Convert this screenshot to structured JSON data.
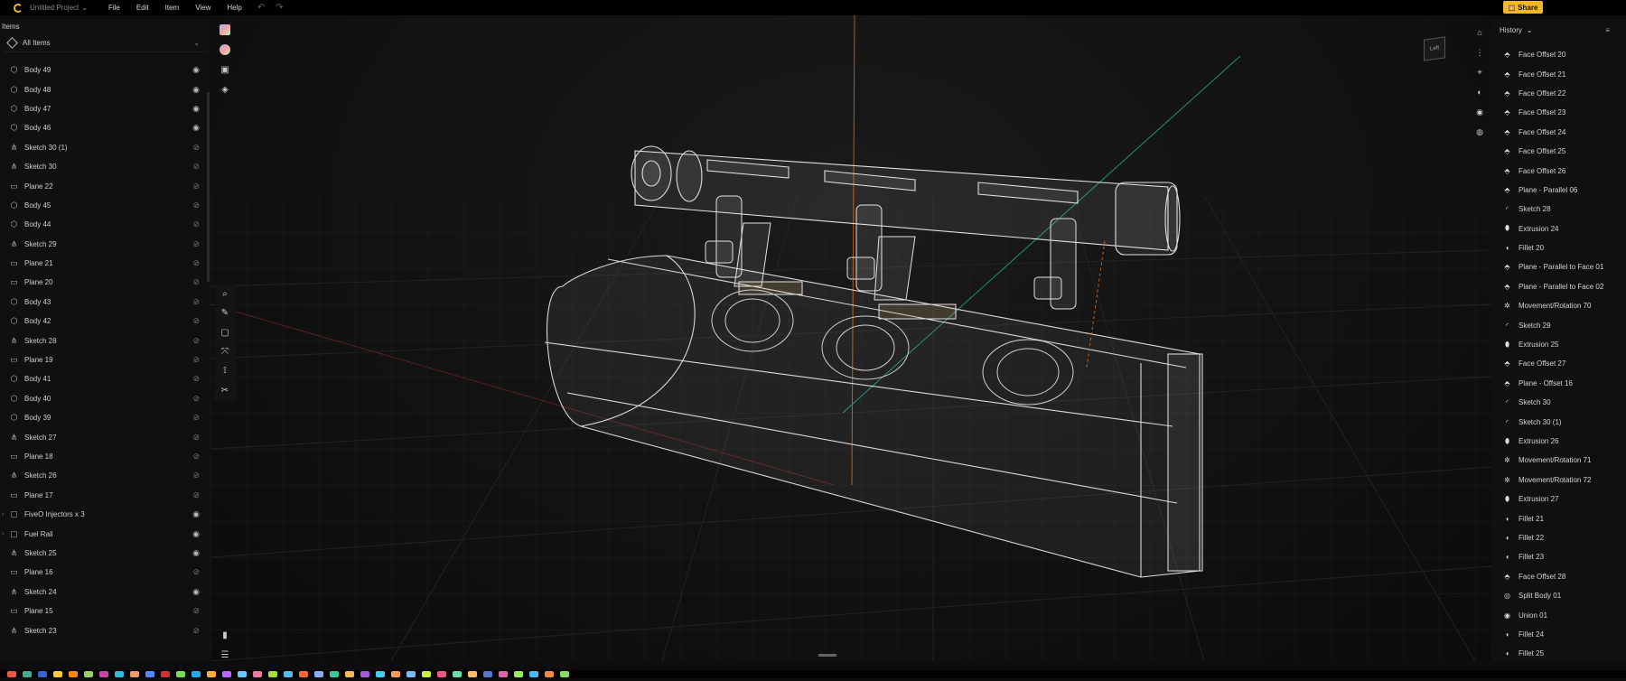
{
  "app": {
    "project_name": "Untitled Project",
    "menu": [
      "File",
      "Edit",
      "Item",
      "View",
      "Help"
    ],
    "share_label": "Share"
  },
  "left_panel": {
    "header": "Items",
    "filter_label": "All Items",
    "items": [
      {
        "label": "Body 49",
        "type": "body",
        "visible": true
      },
      {
        "label": "Body 48",
        "type": "body",
        "visible": true
      },
      {
        "label": "Body 47",
        "type": "body",
        "visible": true
      },
      {
        "label": "Body 46",
        "type": "body",
        "visible": true
      },
      {
        "label": "Sketch 30 (1)",
        "type": "sketch",
        "visible": false
      },
      {
        "label": "Sketch 30",
        "type": "sketch",
        "visible": false
      },
      {
        "label": "Plane 22",
        "type": "plane",
        "visible": false
      },
      {
        "label": "Body 45",
        "type": "body",
        "visible": false
      },
      {
        "label": "Body 44",
        "type": "body",
        "visible": false
      },
      {
        "label": "Sketch 29",
        "type": "sketch",
        "visible": false
      },
      {
        "label": "Plane 21",
        "type": "plane",
        "visible": false
      },
      {
        "label": "Plane 20",
        "type": "plane",
        "visible": false
      },
      {
        "label": "Body 43",
        "type": "body",
        "visible": false
      },
      {
        "label": "Body 42",
        "type": "body",
        "visible": false
      },
      {
        "label": "Sketch 28",
        "type": "sketch",
        "visible": false
      },
      {
        "label": "Plane 19",
        "type": "plane",
        "visible": false
      },
      {
        "label": "Body 41",
        "type": "body",
        "visible": false
      },
      {
        "label": "Body 40",
        "type": "body",
        "visible": false
      },
      {
        "label": "Body 39",
        "type": "body",
        "visible": false
      },
      {
        "label": "Sketch 27",
        "type": "sketch",
        "visible": false
      },
      {
        "label": "Plane 18",
        "type": "plane",
        "visible": false
      },
      {
        "label": "Sketch 26",
        "type": "sketch",
        "visible": false
      },
      {
        "label": "Plane 17",
        "type": "plane",
        "visible": false
      },
      {
        "label": "FiveO Injectors x 3",
        "type": "folder",
        "visible": true,
        "expandable": true
      },
      {
        "label": "Fuel Rail",
        "type": "folder",
        "visible": true,
        "expandable": true
      },
      {
        "label": "Sketch 25",
        "type": "sketch",
        "visible": true
      },
      {
        "label": "Plane 16",
        "type": "plane",
        "visible": false
      },
      {
        "label": "Sketch 24",
        "type": "sketch",
        "visible": true
      },
      {
        "label": "Plane 15",
        "type": "plane",
        "visible": false
      },
      {
        "label": "Sketch 23",
        "type": "sketch",
        "visible": false
      }
    ]
  },
  "right_panel": {
    "header": "History",
    "history": [
      {
        "label": "Face Offset 20",
        "icon": "face"
      },
      {
        "label": "Face Offset 21",
        "icon": "face"
      },
      {
        "label": "Face Offset 22",
        "icon": "face"
      },
      {
        "label": "Face Offset 23",
        "icon": "face"
      },
      {
        "label": "Face Offset 24",
        "icon": "face"
      },
      {
        "label": "Face Offset 25",
        "icon": "face"
      },
      {
        "label": "Face Offset 26",
        "icon": "face"
      },
      {
        "label": "Plane - Parallel 06",
        "icon": "plane"
      },
      {
        "label": "Sketch 28",
        "icon": "sketch"
      },
      {
        "label": "Extrusion 24",
        "icon": "extrude"
      },
      {
        "label": "Fillet 20",
        "icon": "fillet"
      },
      {
        "label": "Plane - Parallel to Face 01",
        "icon": "plane"
      },
      {
        "label": "Plane - Parallel to Face 02",
        "icon": "plane"
      },
      {
        "label": "Movement/Rotation 70",
        "icon": "move"
      },
      {
        "label": "Sketch 29",
        "icon": "sketch"
      },
      {
        "label": "Extrusion 25",
        "icon": "extrude"
      },
      {
        "label": "Face Offset 27",
        "icon": "face"
      },
      {
        "label": "Plane - Offset 16",
        "icon": "plane"
      },
      {
        "label": "Sketch 30",
        "icon": "sketch"
      },
      {
        "label": "Sketch 30 (1)",
        "icon": "sketch"
      },
      {
        "label": "Extrusion 26",
        "icon": "extrude"
      },
      {
        "label": "Movement/Rotation 71",
        "icon": "move"
      },
      {
        "label": "Movement/Rotation 72",
        "icon": "move"
      },
      {
        "label": "Extrusion 27",
        "icon": "extrude"
      },
      {
        "label": "Fillet 21",
        "icon": "fillet"
      },
      {
        "label": "Fillet 22",
        "icon": "fillet"
      },
      {
        "label": "Fillet 23",
        "icon": "fillet"
      },
      {
        "label": "Face Offset 28",
        "icon": "face"
      },
      {
        "label": "Split Body 01",
        "icon": "split"
      },
      {
        "label": "Union 01",
        "icon": "union"
      },
      {
        "label": "Fillet 24",
        "icon": "fillet"
      },
      {
        "label": "Fillet 25",
        "icon": "fillet"
      }
    ]
  },
  "viewport": {
    "nav_cube_label": "Left"
  },
  "colors": {
    "accent": "#f3b72a",
    "background": "#0d0d0d",
    "panel": "#101010",
    "x_axis": "#7a2a2a",
    "y_axis": "#2aa58a",
    "z_axis": "#c2661d"
  }
}
